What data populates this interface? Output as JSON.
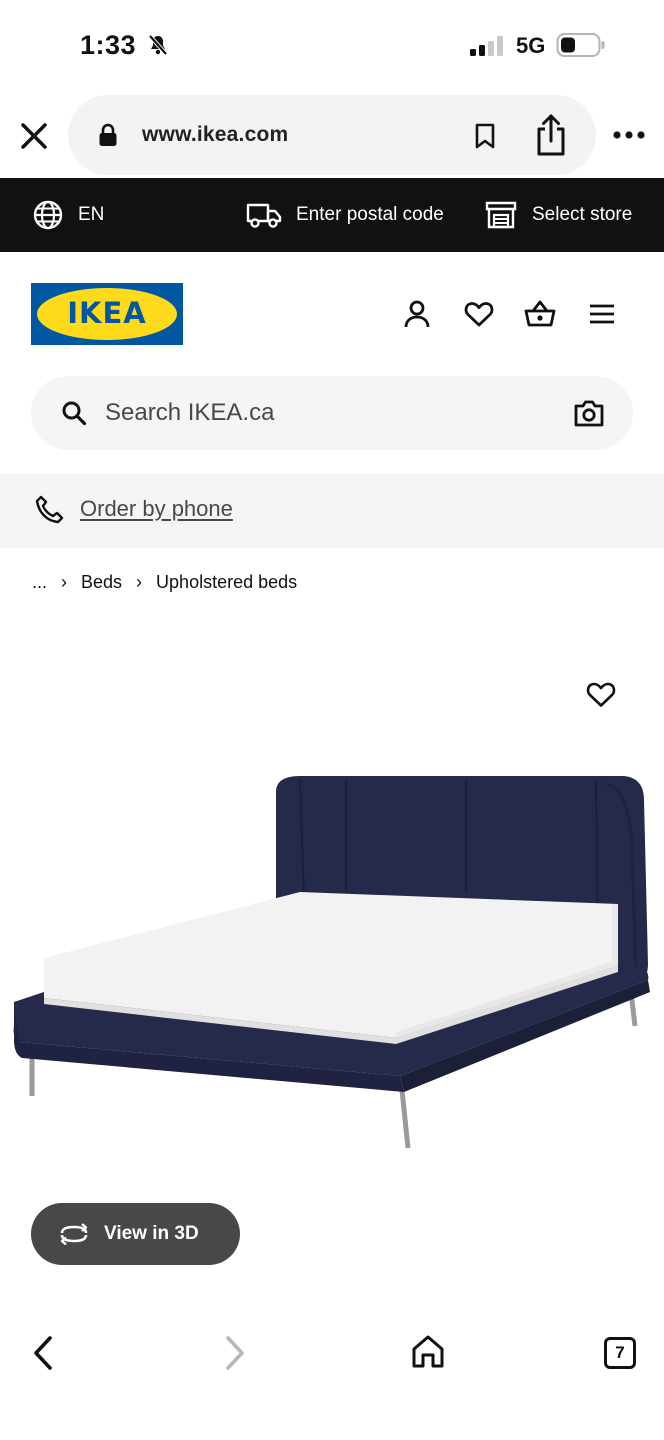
{
  "status_bar": {
    "time": "1:33",
    "network": "5G",
    "icons": [
      "bell-slash-icon",
      "signal-icon",
      "battery-icon"
    ]
  },
  "browser": {
    "url": "www.ikea.com",
    "tab_count": "7",
    "icons": [
      "close-icon",
      "lock-icon",
      "bookmark-icon",
      "share-icon",
      "more-icon",
      "back-icon",
      "forward-icon",
      "home-icon"
    ]
  },
  "utility_bar": {
    "language": "EN",
    "postal_code": "Enter postal code",
    "store": "Select store"
  },
  "header": {
    "logo_text": "IKEA",
    "icons": [
      "account-icon",
      "heart-icon",
      "basket-icon",
      "hamburger-menu-icon"
    ]
  },
  "search": {
    "placeholder": "Search IKEA.ca"
  },
  "phone": {
    "label": "Order by phone"
  },
  "breadcrumb": {
    "ellipsis": "...",
    "items": [
      "Beds",
      "Upholstered beds"
    ]
  },
  "product": {
    "view3d_label": "View in 3D"
  },
  "colors": {
    "ikea_blue": "#0058a3",
    "ikea_yellow": "#ffda1a",
    "utility_bar": "#111111",
    "bed_fabric": "#262a4a",
    "mattress": "#f2f2f2",
    "view3d_button": "#484848"
  }
}
